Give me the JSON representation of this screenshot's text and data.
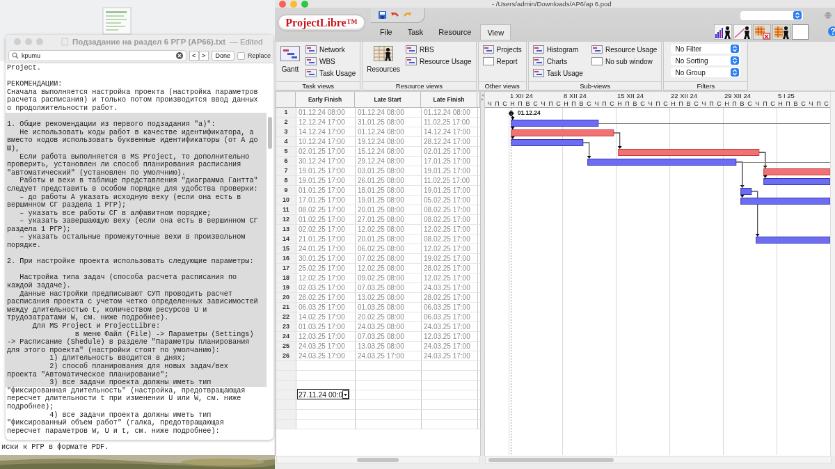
{
  "desktop": {
    "back_window": {
      "text": "иски к РГР в формате PDF."
    }
  },
  "editor": {
    "title": "Подзадание на раздел 6 РГР (АР66).txt",
    "status": "— Edited",
    "find": {
      "value": "kpumu",
      "nav": [
        "<",
        ">"
      ],
      "done": "Done",
      "replace": {
        "label": "Replace",
        "checked": false
      }
    },
    "lines": [
      {
        "text": "Project.",
        "selected": false
      },
      {
        "selected": false
      },
      {
        "text": "РЕКОМЕНДАЦИИ:",
        "selected": false
      },
      {
        "text": "Сначала выполняется настройка проекта (настройка параметров",
        "selected": false
      },
      {
        "text": "расчета расписания) и только потом производится ввод данных",
        "selected": false
      },
      {
        "text": "о продолжительности работ.",
        "selected": false
      },
      {
        "selected": true
      },
      {
        "text": "1. Общие рекомендации из первого подзадания \"а)\":",
        "selected": true
      },
      {
        "text": "   Не использовать коды работ в качестве идентификатора, а",
        "selected": true
      },
      {
        "text": "вместо кодов использовать буквенные идентификаторы (от А до",
        "selected": true
      },
      {
        "text": "Ш),",
        "selected": true
      },
      {
        "text": "   Если работа выполняется в MS Project, то дополнительно",
        "selected": true
      },
      {
        "text": "проверить, установлен ли способ планирования расписания",
        "selected": true
      },
      {
        "text": "\"автоматический\" (установлен по умолчнию).",
        "selected": true
      },
      {
        "text": "   Работы и вехи в таблице представления \"диаграмма Гантта\"",
        "selected": true
      },
      {
        "text": "следует представить в особом порядке для удобства проверки:",
        "selected": true
      },
      {
        "text": "   – до работы А указать исходную веху (если она есть в",
        "selected": true
      },
      {
        "text": "вершинном СГ раздела 1 РГР);",
        "selected": true
      },
      {
        "text": "   – указать все работы СГ в алфавитном порядке;",
        "selected": true
      },
      {
        "text": "   – указать завершающую веху (если она есть в вершинном СГ",
        "selected": true
      },
      {
        "text": "раздела 1 РГР);",
        "selected": true
      },
      {
        "text": "   – указать остальные промежуточные вехи в произвольном",
        "selected": true
      },
      {
        "text": "порядке.",
        "selected": true
      },
      {
        "selected": true
      },
      {
        "text": "2. При настройке проекта использовать следующие параметры:",
        "selected": true
      },
      {
        "selected": true
      },
      {
        "text": "   Настройка типа задач (способа расчета расписания по",
        "selected": true
      },
      {
        "text": "каждой задаче).",
        "selected": true
      },
      {
        "text": "   Данные настройки предписывают СУП проводить расчет",
        "selected": true
      },
      {
        "text": "расписания проекта с учетом четко определенных зависимостей",
        "selected": true
      },
      {
        "text": "между длительностью t, количеством ресурсов U и",
        "selected": true
      },
      {
        "text": "трудозатратами W, см. ниже подробнее).",
        "selected": true
      },
      {
        "text": "      Для MS Project и ProjectLibre:",
        "selected": true
      },
      {
        "text": "                в меню Файл (File) -> Параметры (Settings)",
        "selected": true
      },
      {
        "text": "-> Расписание (Shedule) в разделе \"Параметры планирования",
        "selected": true
      },
      {
        "text": "для этого проекта\" (настройки стоят по умолчанию):",
        "selected": true
      },
      {
        "text": "          1) длительность вводится в днях;",
        "selected": true
      },
      {
        "text": "          2) способ планирования для новых задач/вех",
        "selected": true
      },
      {
        "text": "проекта \"Автоматическое планирование\";",
        "selected": true
      },
      {
        "text": "          3) все задачи проекта должны иметь тип",
        "selected": true
      },
      {
        "text": "\"фиксированная длительность\" (настройка, предотвращающая",
        "selected": false
      },
      {
        "text": "пересчет длительности t при изменении U или W, см. ниже",
        "selected": false
      },
      {
        "text": "подробнее);",
        "selected": false
      },
      {
        "text": "          4) все задачи проекта должны иметь тип",
        "selected": false
      },
      {
        "text": "\"фиксированный объем работ\" (галка, предотвращающая",
        "selected": false
      },
      {
        "text": "пересчет параметров W, U и t, см. ниже подробнее):",
        "selected": false
      }
    ]
  },
  "projectlibre": {
    "title": "- /Users/admin/Downloads/АР6/ар 6.pod",
    "logo": "ProjectLibre™",
    "tabs": [
      {
        "label": "File",
        "selected": false
      },
      {
        "label": "Task",
        "selected": false
      },
      {
        "label": "Resource",
        "selected": false
      },
      {
        "label": "View",
        "selected": true
      }
    ],
    "ribbon": [
      {
        "label": "Task views",
        "big": "Gantt",
        "items": [
          {
            "label": "Network",
            "kind": "view"
          },
          {
            "label": "WBS",
            "kind": "view"
          },
          {
            "label": "Task Usage",
            "kind": "view"
          }
        ]
      },
      {
        "label": "Resource views",
        "big": "Resources",
        "items": [
          {
            "label": "RBS",
            "kind": "view"
          },
          {
            "label": "Resource Usage",
            "kind": "view"
          }
        ]
      },
      {
        "label": "Other views",
        "items": [
          {
            "label": "Projects",
            "kind": "view"
          },
          {
            "label": "Report",
            "kind": "blank"
          }
        ]
      },
      {
        "label": "Sub-views",
        "items": [
          {
            "label": "Histogram",
            "kind": "view"
          },
          {
            "label": "Charts",
            "kind": "view"
          },
          {
            "label": "Task Usage",
            "kind": "view"
          },
          {
            "label": "Resource Usage",
            "kind": "view"
          },
          {
            "label": "No sub window",
            "kind": "blank"
          }
        ]
      },
      {
        "label": "Filters",
        "dropdowns": [
          "No Filter",
          "No Sorting",
          "No Group"
        ]
      }
    ],
    "table": {
      "columns": [
        "Early Finish",
        "Late Start",
        "Late Finish"
      ],
      "rows": [
        {
          "id": "1",
          "cells": [
            "01.12.24 08:00",
            "01.12.24 08:00",
            "01.12.24 08:00"
          ],
          "milestone": {
            "label": "01.12.24"
          }
        },
        {
          "id": "2",
          "cells": [
            "12.12.24 17:00",
            "31.01.25 08:00",
            "11.02.25 17:00"
          ]
        },
        {
          "id": "3",
          "cells": [
            "14.12.24 17:00",
            "01.12.24 08:00",
            "14.12.24 17:00"
          ]
        },
        {
          "id": "4",
          "cells": [
            "10.12.24 17:00",
            "19.12.24 08:00",
            "28.12.24 17:00"
          ]
        },
        {
          "id": "5",
          "cells": [
            "02.01.25 17:00",
            "15.12.24 08:00",
            "02.01.25 17:00"
          ]
        },
        {
          "id": "6",
          "cells": [
            "30.12.24 17:00",
            "29.12.24 08:00",
            "17.01.25 17:00"
          ]
        },
        {
          "id": "7",
          "cells": [
            "19.01.25 17:00",
            "03.01.25 08:00",
            "19.01.25 17:00"
          ]
        },
        {
          "id": "8",
          "cells": [
            "19.01.25 17:00",
            "26.01.25 08:00",
            "11.02.25 17:00"
          ]
        },
        {
          "id": "9",
          "cells": [
            "01.01.25 17:00",
            "18.01.25 08:00",
            "19.01.25 17:00"
          ]
        },
        {
          "id": "10",
          "cells": [
            "17.01.25 17:00",
            "19.01.25 08:00",
            "05.02.25 17:00"
          ]
        },
        {
          "id": "11",
          "cells": [
            "08.02.25 17:00",
            "20.01.25 08:00",
            "08.02.25 17:00"
          ]
        },
        {
          "id": "12",
          "cells": [
            "01.02.25 17:00",
            "27.01.25 08:00",
            "08.02.25 17:00"
          ]
        },
        {
          "id": "13",
          "cells": [
            "02.02.25 17:00",
            "12.02.25 08:00",
            "12.02.25 17:00"
          ]
        },
        {
          "id": "14",
          "cells": [
            "21.01.25 17:00",
            "20.01.25 08:00",
            "08.02.25 17:00"
          ]
        },
        {
          "id": "15",
          "cells": [
            "24.01.25 17:00",
            "06.02.25 08:00",
            "12.02.25 17:00"
          ]
        },
        {
          "id": "16",
          "cells": [
            "30.01.25 17:00",
            "07.02.25 08:00",
            "19.02.25 17:00"
          ]
        },
        {
          "id": "17",
          "cells": [
            "25.02.25 17:00",
            "12.02.25 08:00",
            "28.02.25 17:00"
          ]
        },
        {
          "id": "18",
          "cells": [
            "12.02.25 17:00",
            "09.02.25 08:00",
            "12.02.25 17:00"
          ]
        },
        {
          "id": "19",
          "cells": [
            "02.03.25 17:00",
            "07.03.25 08:00",
            "24.03.25 17:00"
          ]
        },
        {
          "id": "20",
          "cells": [
            "28.02.25 17:00",
            "13.02.25 08:00",
            "28.02.25 17:00"
          ]
        },
        {
          "id": "21",
          "cells": [
            "06.03.25 17:00",
            "01.03.25 08:00",
            "06.03.25 17:00"
          ]
        },
        {
          "id": "22",
          "cells": [
            "14.02.25 17:00",
            "20.02.25 08:00",
            "06.03.25 17:00"
          ]
        },
        {
          "id": "23",
          "cells": [
            "01.03.25 17:00",
            "24.03.25 08:00",
            "24.03.25 17:00"
          ]
        },
        {
          "id": "24",
          "cells": [
            "12.03.25 17:00",
            "07.03.25 08:00",
            "12.03.25 17:00"
          ]
        },
        {
          "id": "25",
          "cells": [
            "24.03.25 17:00",
            "13.03.25 08:00",
            "24.03.25 17:00"
          ]
        },
        {
          "id": "26",
          "cells": [
            "24.03.25 17:00",
            "24.03.25 17:00",
            "24.03.25 17:00"
          ]
        }
      ],
      "editor": {
        "value": "27.11.24 00:0"
      }
    },
    "gantt": {
      "weeks": [
        {
          "days": [
            "Ч",
            "П",
            "С"
          ]
        },
        {
          "label": "1 XII 24",
          "days": [
            "Н",
            "П",
            "В",
            "С",
            "Ч",
            "П",
            "С"
          ]
        },
        {
          "label": "8 XII 24",
          "days": [
            "Н",
            "П",
            "В",
            "С",
            "Ч",
            "П",
            "С"
          ]
        },
        {
          "label": "15 XII 24",
          "days": [
            "Н",
            "П",
            "В",
            "С",
            "Ч",
            "П",
            "С"
          ]
        },
        {
          "label": "22 XII 24",
          "days": [
            "Н",
            "П",
            "В",
            "С",
            "Ч",
            "П",
            "С"
          ]
        },
        {
          "label": "29 XII 24",
          "days": [
            "Н",
            "П",
            "В",
            "С",
            "Ч",
            "П",
            "С"
          ]
        },
        {
          "label": "5 I 25",
          "days": [
            "Н",
            "П",
            "В",
            "С",
            "Ч",
            "П",
            "С"
          ]
        }
      ]
    }
  }
}
